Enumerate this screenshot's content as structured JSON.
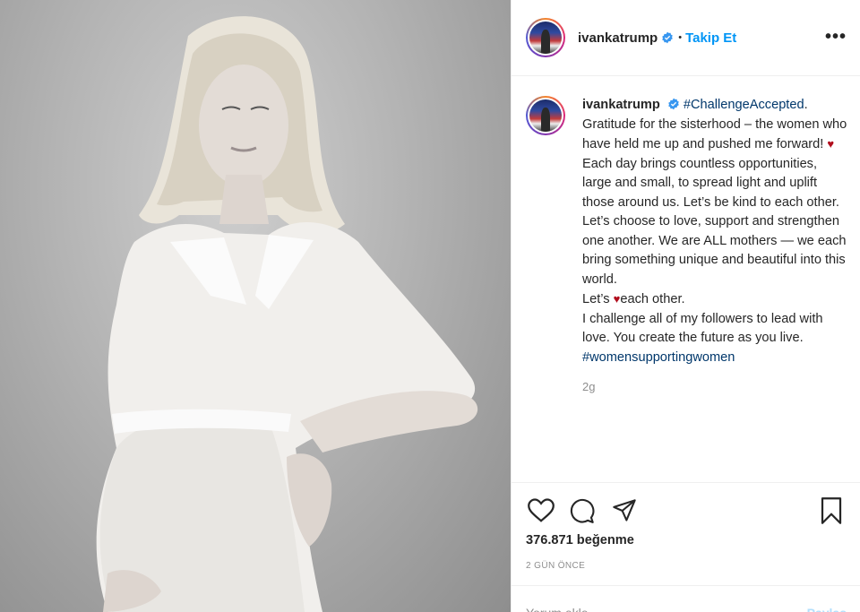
{
  "header": {
    "username": "ivankatrump",
    "separator": "•",
    "follow_label": "Takip Et",
    "more_label": "•••"
  },
  "caption": {
    "username": "ivankatrump",
    "hashtag_challenge": "#ChallengeAccepted",
    "para1_a": ". Gratitude for the sisterhood – the women who have held me up and pushed me forward! ",
    "heart": "♥",
    "para2": "Each day brings countless opportunities, large and small, to spread light and uplift those around us. Let’s be kind to each other. Let’s choose to love, support and strengthen one another. We are ALL mothers — we each bring something unique and beautiful into this world.",
    "para3_a": "Let’s ",
    "para3_b": "each other.",
    "para4": "I challenge all of my followers to lead with love. You create the future as you live.",
    "hashtag_women": "#womensupportingwomen",
    "time": "2g"
  },
  "actions": {
    "likes": "376.871 beğenme",
    "date": "2 GÜN ÖNCE",
    "comment_placeholder": "Yorum ekle...",
    "post_label": "Paylaş"
  },
  "icons": [
    "heart-outline-icon",
    "comment-icon",
    "share-icon",
    "bookmark-icon",
    "verified-badge-icon",
    "more-options-icon"
  ],
  "colors": {
    "link_blue": "#0095f6",
    "hashtag": "#00376b",
    "heart_red": "#b10d1d",
    "muted": "#8e8e8e"
  }
}
